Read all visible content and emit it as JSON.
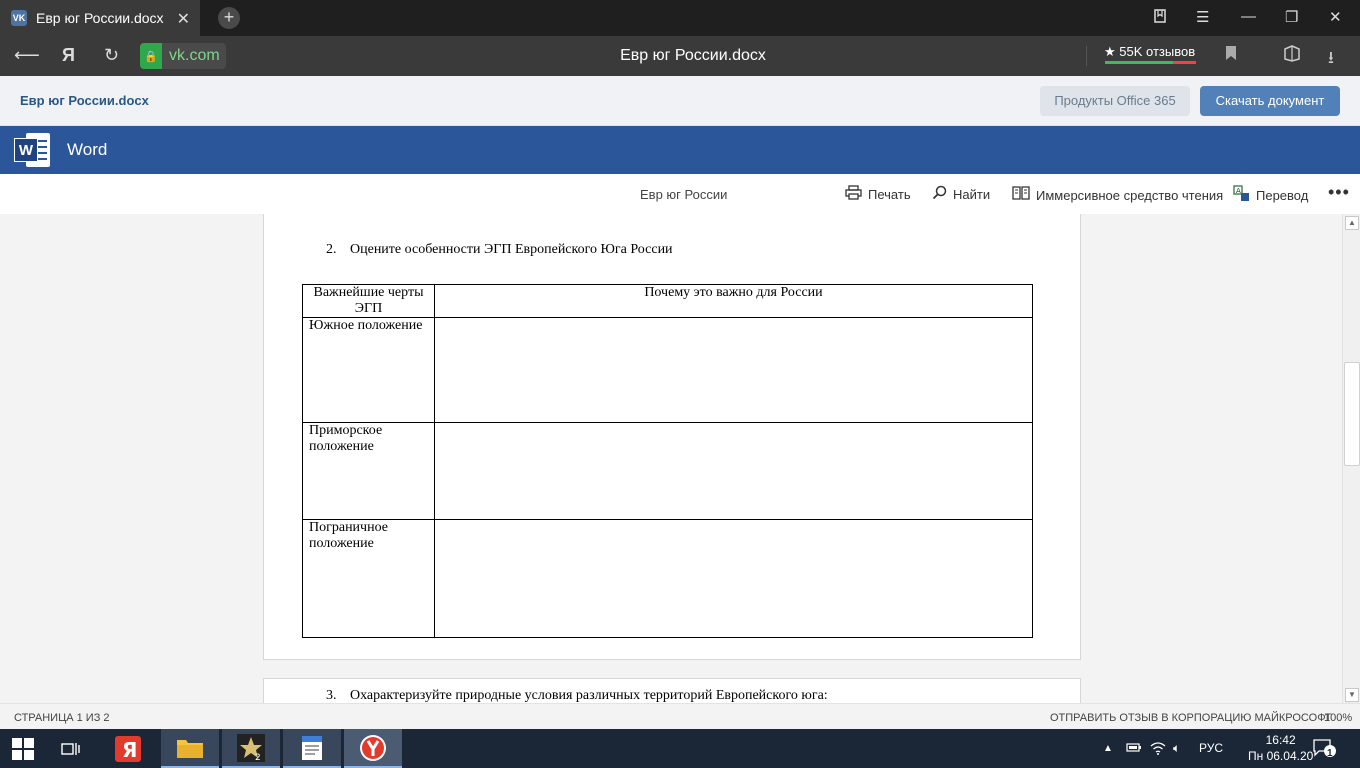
{
  "browser": {
    "tab_title": "Евр юг России.docx",
    "tab_favicon": "VK",
    "url": "vk.com",
    "page_title": "Евр юг России.docx",
    "reviews_label": "★ 55K отзывов"
  },
  "vk_header": {
    "doc_title": "Евр юг России.docx",
    "office_button": "Продукты Office 365",
    "download_button": "Скачать документ"
  },
  "word_bar": {
    "app_name": "Word",
    "logo_letter": "W"
  },
  "command_bar": {
    "doc_title": "Евр юг России",
    "print": "Печать",
    "find": "Найти",
    "immersive_reader": "Иммерсивное средство чтения",
    "translate": "Перевод",
    "more": "•••"
  },
  "document": {
    "task2": {
      "number": "2.",
      "text": "Оцените особенности ЭГП Европейского Юга России"
    },
    "table": {
      "headers": [
        "Важнейшие черты ЭГП",
        "Почему это важно для России"
      ],
      "rows": [
        "Южное положение",
        "Приморское положение",
        "Пограничное положение"
      ]
    },
    "task3": {
      "number": "3.",
      "text": "Охарактеризуйте природные условия различных территорий Европейского юга:"
    }
  },
  "status_bar": {
    "page_info": "СТРАНИЦА 1 ИЗ 2",
    "feedback": "ОТПРАВИТЬ ОТЗЫВ В КОРПОРАЦИЮ МАЙКРОСОФТ",
    "zoom": "100%"
  },
  "taskbar": {
    "language": "РУС",
    "time": "16:42",
    "date": "Пн 06.04.20",
    "notifications": "1"
  }
}
